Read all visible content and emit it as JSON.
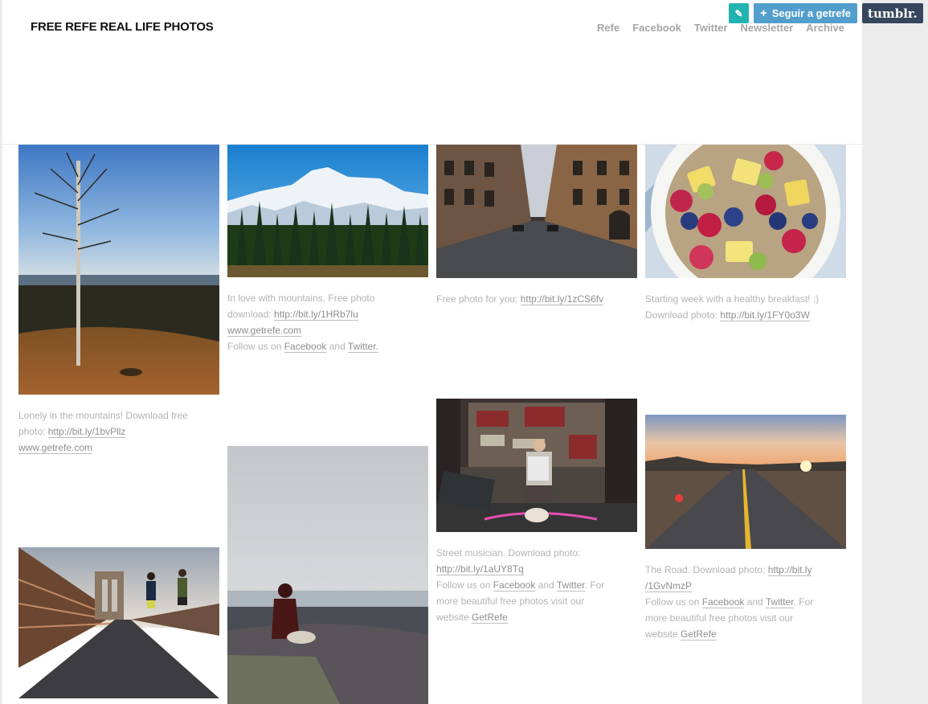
{
  "site": {
    "title": "FREE REFE REAL LIFE PHOTOS"
  },
  "nav": [
    "Refe",
    "Facebook",
    "Twitter",
    "Newsletter",
    "Archive"
  ],
  "tumblr": {
    "follow_label": "Seguir a getrefe",
    "logo": "tumblr."
  },
  "posts": {
    "tree": {
      "c1": "Lonely in the mountains! Download free",
      "c2a": "photo: ",
      "c2b": "http://bit.ly/1bvPllz",
      "c3": "www.getrefe.com"
    },
    "mountains": {
      "c1": "In love with mountains. Free photo",
      "c2a": "download: ",
      "c2b": "http://bit.ly/1HRb7lu",
      "c3": "www.getrefe.com",
      "c4a": "Follow us on ",
      "c4b": "Facebook",
      "c4c": " and ",
      "c4d": "Twitter."
    },
    "street": {
      "c1a": "Free photo for you: ",
      "c1b": "http://bit.ly/1zCS6fv"
    },
    "breakfast": {
      "c1": "Starting week with a healthy breakfast! ;)",
      "c2a": "Download photo: ",
      "c2b": "http://bit.ly/1FY0o3W"
    },
    "musician": {
      "c1": "Street musician. Download photo:",
      "c2": "http://bit.ly/1aUY8Tq",
      "c3a": "Follow us on ",
      "c3b": "Facebook",
      "c3c": " and ",
      "c3d": "Twitter",
      "c3e": ". For",
      "c4": "more beautiful free photos visit our",
      "c5a": "website ",
      "c5b": "GetRefe"
    },
    "road": {
      "c1a": "The Road. Download photo: ",
      "c1b": "http://bit.ly",
      "c2": "/1GvNmzP",
      "c3a": "Follow us on ",
      "c3b": "Facebook",
      "c3c": " and ",
      "c3d": "Twitter",
      "c3e": ". For",
      "c4": "more beautiful free photos visit our",
      "c5a": "website ",
      "c5b": "GetRefe"
    }
  },
  "colors": {
    "accent_follow": "#529ecc",
    "tumblr_navy": "#36465d",
    "share_teal": "#20b4b0"
  }
}
